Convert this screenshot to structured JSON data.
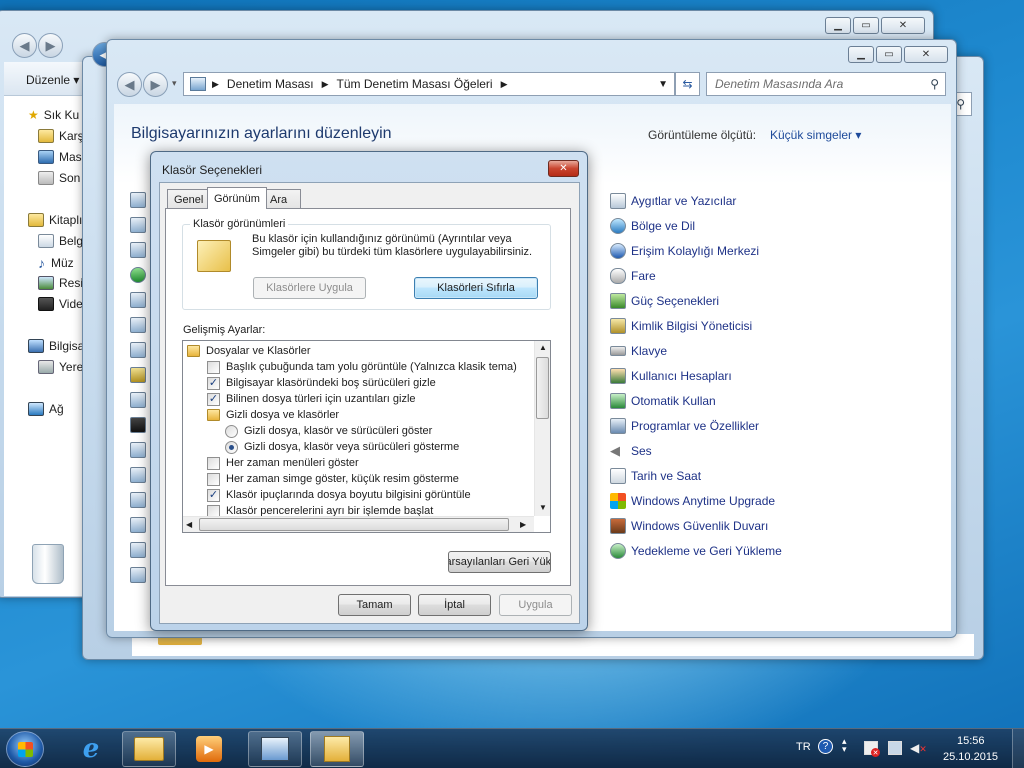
{
  "back_window_1": {
    "toolbar_organize": "Düzenle ▾",
    "nav": [
      "Sık Ku",
      "Karş",
      "Masa",
      "Son",
      "Kitaplı",
      "Belg",
      "Müz",
      "Resi",
      "Vide",
      "Bilgisa",
      "Yere",
      "Ağ"
    ]
  },
  "cp_window": {
    "breadcrumb": [
      "Denetim Masası",
      "Tüm Denetim Masası Öğeleri"
    ],
    "search_placeholder": "Denetim Masasında Ara",
    "heading": "Bilgisayarınızın ayarlarını düzenleyin",
    "view_by_label": "Görüntüleme ölçütü:",
    "view_by_value": "Küçük simgeler ▾",
    "items": [
      "Aygıtlar ve Yazıcılar",
      "Bölge ve Dil",
      "Erişim Kolaylığı Merkezi",
      "Fare",
      "Güç Seçenekleri",
      "Kimlik Bilgisi Yöneticisi",
      "Klavye",
      "Kullanıcı Hesapları",
      "Otomatik Kullan",
      "Programlar ve Özellikler",
      "Ses",
      "Tarih ve Saat",
      "Windows Anytime Upgrade",
      "Windows Güvenlik Duvarı",
      "Yedekleme ve Geri Yükleme"
    ],
    "item_icons": [
      "printer-icon",
      "globe-icon",
      "accessibility-icon",
      "mouse-icon",
      "battery-icon",
      "credential-icon",
      "keyboard-icon",
      "users-icon",
      "autoplay-icon",
      "programs-icon",
      "speaker-icon",
      "clock-icon",
      "upgrade-icon",
      "firewall-icon",
      "backup-icon"
    ]
  },
  "dialog": {
    "title": "Klasör Seçenekleri",
    "close_glyph": "✕",
    "tabs": [
      "Genel",
      "Görünüm",
      "Ara"
    ],
    "group_title": "Klasör görünümleri",
    "group_text": "Bu klasör için kullandığınız görünümü (Ayrıntılar veya Simgeler gibi) bu türdeki tüm klasörlere uygulayabilirsiniz.",
    "apply_folders": "Klasörlere Uygula",
    "reset_folders": "Klasörleri Sıfırla",
    "advanced_label": "Gelişmiş Ayarlar:",
    "tree": [
      {
        "type": "folder",
        "text": "Dosyalar ve Klasörler",
        "indent": 0
      },
      {
        "type": "check",
        "checked": false,
        "text": "Başlık çubuğunda tam yolu görüntüle (Yalnızca klasik tema)",
        "indent": 1
      },
      {
        "type": "check",
        "checked": true,
        "text": "Bilgisayar klasöründeki boş sürücüleri gizle",
        "indent": 1
      },
      {
        "type": "check",
        "checked": true,
        "text": "Bilinen dosya türleri için uzantıları gizle",
        "indent": 1
      },
      {
        "type": "folder",
        "text": "Gizli dosya ve klasörler",
        "indent": 1
      },
      {
        "type": "radio",
        "checked": false,
        "text": "Gizli dosya, klasör ve sürücüleri göster",
        "indent": 2
      },
      {
        "type": "radio",
        "checked": true,
        "text": "Gizli dosya, klasör veya sürücüleri gösterme",
        "indent": 2
      },
      {
        "type": "check",
        "checked": false,
        "text": "Her zaman menüleri göster",
        "indent": 1
      },
      {
        "type": "check",
        "checked": false,
        "text": "Her zaman simge göster, küçük resim gösterme",
        "indent": 1
      },
      {
        "type": "check",
        "checked": true,
        "text": "Klasör ipuçlarında dosya boyutu bilgisini görüntüle",
        "indent": 1
      },
      {
        "type": "check",
        "checked": false,
        "text": "Klasör pencerelerini ayrı bir işlemde başlat",
        "indent": 1
      }
    ],
    "restore_defaults": "arsayılanları Geri Yükl",
    "ok": "Tamam",
    "cancel": "İptal",
    "apply": "Uygula"
  },
  "taskbar": {
    "language": "TR",
    "time": "15:56",
    "date": "25.10.2015"
  }
}
